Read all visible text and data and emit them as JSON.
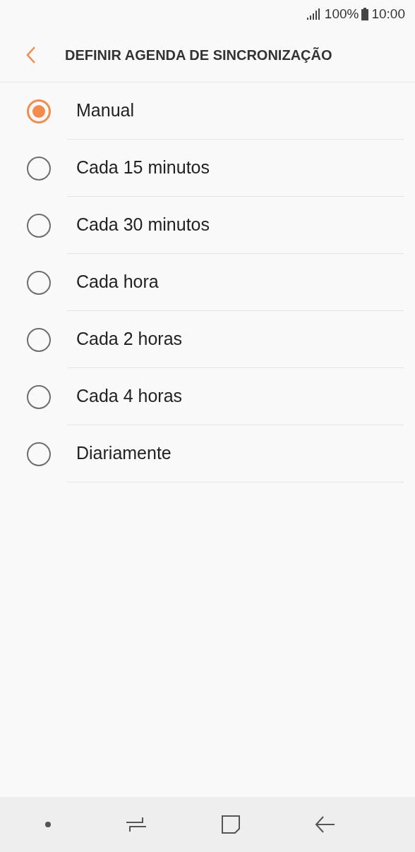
{
  "status_bar": {
    "battery": "100%",
    "time": "10:00"
  },
  "header": {
    "title": "DEFINIR AGENDA DE SINCRONIZAÇÃO"
  },
  "options": [
    {
      "label": "Manual",
      "selected": true
    },
    {
      "label": "Cada 15 minutos",
      "selected": false
    },
    {
      "label": "Cada 30 minutos",
      "selected": false
    },
    {
      "label": "Cada hora",
      "selected": false
    },
    {
      "label": "Cada 2 horas",
      "selected": false
    },
    {
      "label": "Cada 4 horas",
      "selected": false
    },
    {
      "label": "Diariamente",
      "selected": false
    }
  ]
}
